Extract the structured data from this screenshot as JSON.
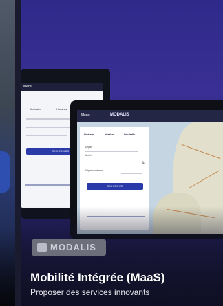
{
  "card": {
    "title": "Mobilité Intégrée (MaaS)",
    "subtitle": "Proposer des services innovants"
  },
  "brand": {
    "logo_text": "MODALIS"
  },
  "mockup_app": {
    "menu_label": "Menu",
    "logo_label": "MODALIS",
    "tabs": [
      "Itinéraire",
      "Horaires",
      "Info trafic"
    ],
    "fields": [
      "Départ",
      "Arrivée"
    ],
    "departure_label": "Départ maintenant",
    "search_button": "RECHERCHER"
  },
  "colors": {
    "card_gradient_top": "#2e2a8a",
    "accent_blue": "#2a3aa8",
    "app_bar": "#232645"
  },
  "icons": [
    "logo-mark-icon",
    "swap-icon"
  ]
}
